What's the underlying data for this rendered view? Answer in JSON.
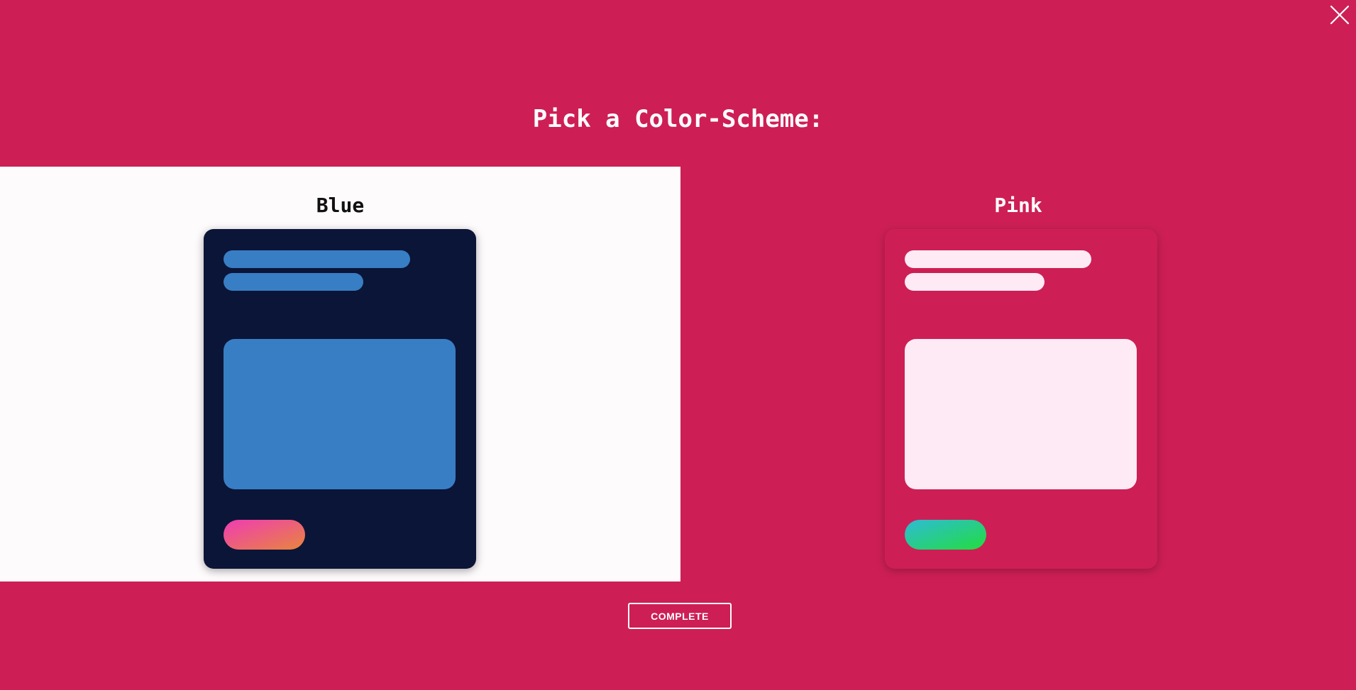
{
  "modal": {
    "title": "Pick a Color-Scheme:",
    "close_icon": "close-icon",
    "complete_label": "COMPLETE"
  },
  "schemes": [
    {
      "label": "Blue",
      "selected": true,
      "colors": {
        "card": "#0b1537",
        "lines": "#387ec5",
        "block": "#387ec5",
        "pill_gradient": [
          "#f03cb4",
          "#e8853d"
        ]
      }
    },
    {
      "label": "Pink",
      "selected": false,
      "colors": {
        "card": "#cd1f55",
        "lines": "#fdeaf4",
        "block": "#fdeaf4",
        "pill_gradient": [
          "#2ebbd6",
          "#22dd3e"
        ]
      }
    }
  ],
  "colors": {
    "background": "#cd1f55",
    "selected_panel": "#fefbfd",
    "text_light": "#ffffff",
    "text_dark": "#111111"
  }
}
